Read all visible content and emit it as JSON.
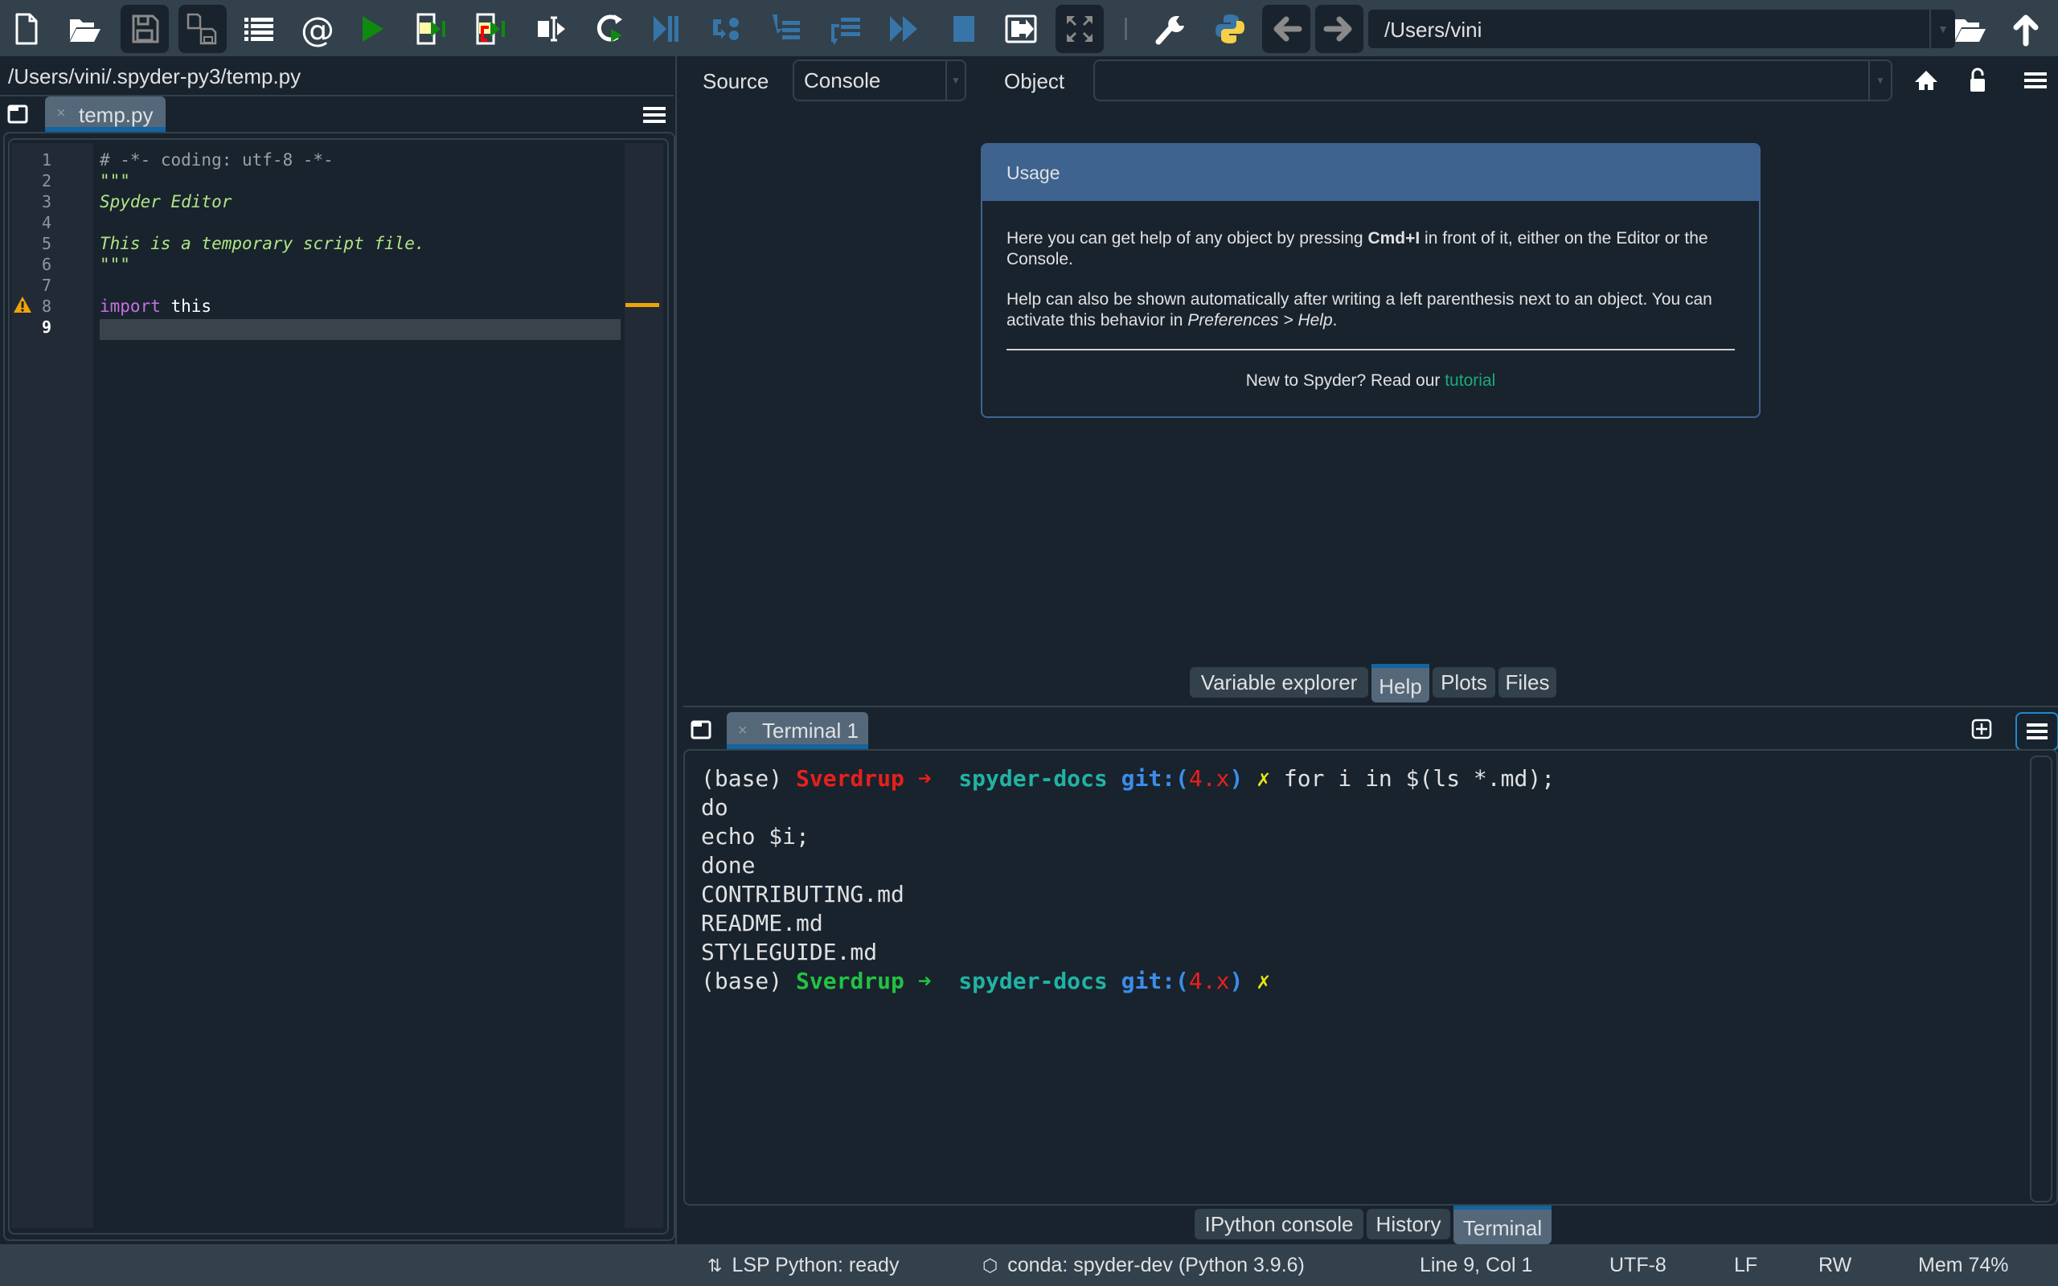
{
  "toolbar": {
    "buttons": [
      {
        "name": "new-file",
        "label": "New file"
      },
      {
        "name": "open-file",
        "label": "Open file"
      },
      {
        "name": "save-file",
        "label": "Save file"
      },
      {
        "name": "save-all",
        "label": "Save all"
      },
      {
        "name": "outline",
        "label": "Outline"
      },
      {
        "name": "at",
        "label": "@"
      },
      {
        "name": "run",
        "label": "Run"
      },
      {
        "name": "run-cell",
        "label": "Run cell"
      },
      {
        "name": "run-cell-advance",
        "label": "Run cell and advance"
      },
      {
        "name": "run-selection",
        "label": "Run selection"
      },
      {
        "name": "rerun",
        "label": "Re-run last script"
      },
      {
        "name": "debug",
        "label": "Debug"
      },
      {
        "name": "step",
        "label": "Step"
      },
      {
        "name": "step-into",
        "label": "Step into"
      },
      {
        "name": "step-return",
        "label": "Step return"
      },
      {
        "name": "continue",
        "label": "Continue"
      },
      {
        "name": "stop",
        "label": "Stop"
      },
      {
        "name": "maximize-pane",
        "label": "Maximize current pane"
      },
      {
        "name": "fullscreen",
        "label": "Fullscreen"
      },
      {
        "name": "preferences",
        "label": "Preferences"
      },
      {
        "name": "pythonpath",
        "label": "PYTHONPATH manager"
      },
      {
        "name": "back",
        "label": "Back"
      },
      {
        "name": "forward",
        "label": "Forward"
      }
    ],
    "working_directory": "/Users/vini"
  },
  "editor": {
    "file_path": "/Users/vini/.spyder-py3/temp.py",
    "tab_label": "temp.py",
    "tab_close": "×",
    "current_line": 9,
    "lines": [
      {
        "n": "1",
        "text": "# -*- coding: utf-8 -*-",
        "kind": "comment"
      },
      {
        "n": "2",
        "text": "\"\"\"",
        "kind": "string"
      },
      {
        "n": "3",
        "text": "Spyder Editor",
        "kind": "string"
      },
      {
        "n": "4",
        "text": "",
        "kind": "string"
      },
      {
        "n": "5",
        "text": "This is a temporary script file.",
        "kind": "string"
      },
      {
        "n": "6",
        "text": "\"\"\"",
        "kind": "string"
      },
      {
        "n": "7",
        "text": "",
        "kind": "plain"
      },
      {
        "n": "8",
        "keyword": "import",
        "text": " this",
        "kind": "import",
        "warning": true
      },
      {
        "n": "9",
        "text": "",
        "kind": "plain"
      }
    ]
  },
  "help": {
    "source_label": "Source",
    "source_value": "Console",
    "object_label": "Object",
    "object_value": "",
    "usage_title": "Usage",
    "para1_a": "Here you can get help of any object by pressing ",
    "para1_bold": "Cmd+I",
    "para1_b": " in front of it, either on the Editor or the Console.",
    "para2_a": "Help can also be shown automatically after writing a left parenthesis next to an object. You can activate this behavior in ",
    "para2_em": "Preferences > Help",
    "para2_b": ".",
    "footer_text": "New to Spyder? Read our ",
    "footer_link": "tutorial"
  },
  "top_tabs": [
    {
      "label": "Variable explorer",
      "active": false
    },
    {
      "label": "Help",
      "active": true
    },
    {
      "label": "Plots",
      "active": false
    },
    {
      "label": "Files",
      "active": false
    }
  ],
  "terminal": {
    "tab_label": "Terminal 1",
    "tab_close": "×",
    "lines": [
      {
        "segments": [
          {
            "t": "(base) ",
            "c": "#e0e1e3"
          },
          {
            "t": "Sverdrup",
            "c": "#e8201c",
            "b": true
          },
          {
            "t": " ➜  ",
            "c": "#e8201c"
          },
          {
            "t": "spyder-docs",
            "c": "#21b3a5",
            "b": true
          },
          {
            "t": " git:(",
            "c": "#3b8eea",
            "b": true
          },
          {
            "t": "4.x",
            "c": "#e8201c"
          },
          {
            "t": ")",
            "c": "#3b8eea",
            "b": true
          },
          {
            "t": " ✗",
            "c": "#e5e510"
          },
          {
            "t": " for i in $(ls *.md);",
            "c": "#e0e1e3"
          }
        ]
      },
      {
        "segments": [
          {
            "t": "do",
            "c": "#e0e1e3"
          }
        ]
      },
      {
        "segments": [
          {
            "t": "echo $i;",
            "c": "#e0e1e3"
          }
        ]
      },
      {
        "segments": [
          {
            "t": "done",
            "c": "#e0e1e3"
          }
        ]
      },
      {
        "segments": [
          {
            "t": "CONTRIBUTING.md",
            "c": "#e0e1e3"
          }
        ]
      },
      {
        "segments": [
          {
            "t": "README.md",
            "c": "#e0e1e3"
          }
        ]
      },
      {
        "segments": [
          {
            "t": "STYLEGUIDE.md",
            "c": "#e0e1e3"
          }
        ]
      },
      {
        "segments": [
          {
            "t": "(base) ",
            "c": "#e0e1e3"
          },
          {
            "t": "Sverdrup",
            "c": "#23c243",
            "b": true
          },
          {
            "t": " ➜  ",
            "c": "#23c243"
          },
          {
            "t": "spyder-docs",
            "c": "#21b3a5",
            "b": true
          },
          {
            "t": " git:(",
            "c": "#3b8eea",
            "b": true
          },
          {
            "t": "4.x",
            "c": "#e8201c"
          },
          {
            "t": ")",
            "c": "#3b8eea",
            "b": true
          },
          {
            "t": " ✗",
            "c": "#e5e510"
          }
        ]
      }
    ]
  },
  "bottom_tabs": [
    {
      "label": "IPython console",
      "active": false
    },
    {
      "label": "History",
      "active": false
    },
    {
      "label": "Terminal",
      "active": true
    }
  ],
  "status": {
    "lsp": "LSP Python: ready",
    "conda": "conda: spyder-dev (Python 3.9.6)",
    "position": "Line 9, Col 1",
    "encoding": "UTF-8",
    "eol": "LF",
    "mode": "RW",
    "memory": "Mem 74%"
  },
  "colors": {
    "accent": "#1464a0",
    "usage_header": "#3f638f",
    "link": "#1aaa7a",
    "warning": "#f0a30a"
  }
}
